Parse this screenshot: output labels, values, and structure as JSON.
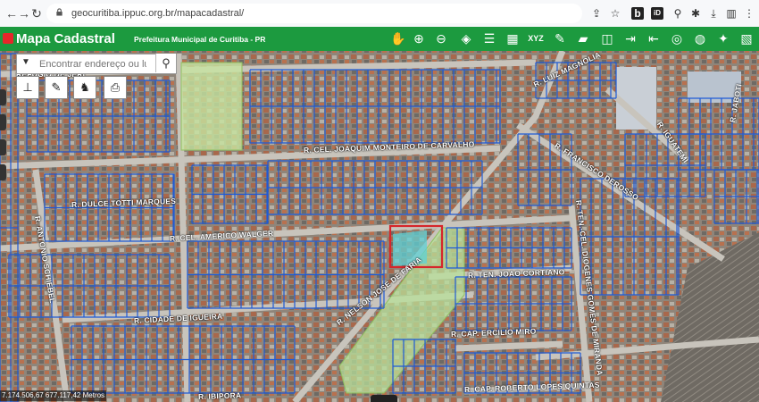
{
  "browser": {
    "url": "geocuritiba.ippuc.org.br/mapacadastral/",
    "back_icon": "back-arrow-icon",
    "forward_icon": "forward-arrow-icon",
    "reload_icon": "reload-icon"
  },
  "app": {
    "title": "Mapa Cadastral",
    "subtitle": "Prefeitura Municipal de Curitiba - PR",
    "header_color": "#1c9a3f"
  },
  "search": {
    "placeholder": "Encontrar endereço ou lugar"
  },
  "map": {
    "coordinates": "7.174.506,67 677.117,42 Metros",
    "highlight_color": "#d6262b",
    "lot_line_color": "#1f5bd6",
    "streets": [
      "R. CEL. JOAQUIM MONTEIRO DE CARVALHO",
      "R. CEL. AMERICO WALGER",
      "R. DULCE TOTTI MARQUES",
      "R. ANTONIO SCHIEBEL",
      "R. CIDADE DE IGUEIRA",
      "R. NELSON JOSE DE FARIA",
      "R. TEN. JOAO CORTIANO",
      "R. CAP. ERCILIO MIRO",
      "R. CAP. ROBERTO LOPES QUINTAS",
      "R. IBIPORA",
      "R. FRANCISCO DEROSSO",
      "R. TEN.-CEL. DIOGENES GOMES DE MIRANDA",
      "R. IGUATEMI",
      "R. JABOTI",
      "R. LUIZ MAGNOLIA",
      "REFUGIO DE JERI"
    ]
  }
}
